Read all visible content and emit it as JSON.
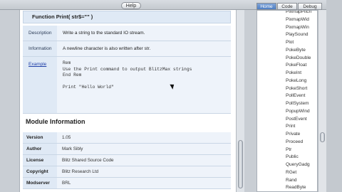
{
  "toolbar": {
    "help_label": "Help"
  },
  "function": {
    "title": "Function Print( str$=\"\" )",
    "rows": [
      {
        "key": "Description",
        "value": "Write a string to the standard IO stream."
      },
      {
        "key": "Information",
        "value": "A newline character is also written after str."
      }
    ],
    "example_key": "Example",
    "example_code": "Rem\nUse the Print command to output BlitzMax strings\nEnd Rem\n\nPrint \"Hello World\""
  },
  "module": {
    "title": "Module Information",
    "rows": [
      {
        "key": "Version",
        "value": "1.05"
      },
      {
        "key": "Author",
        "value": "Mark Sibly"
      },
      {
        "key": "License",
        "value": "Blitz Shared Source Code"
      },
      {
        "key": "Copyright",
        "value": "Blitz Research Ltd"
      },
      {
        "key": "Modserver",
        "value": "BRL"
      }
    ]
  },
  "sidebar": {
    "tabs": [
      "Home",
      "Code",
      "Debug"
    ],
    "active_tab": "Home",
    "items": [
      "PixmapPitch",
      "PixmapWid",
      "PixmapWin",
      "PlaySound",
      "Plot",
      "PokeByte",
      "PokeDouble",
      "PokeFloat",
      "PokeInt",
      "PokeLong",
      "PokeShort",
      "PollEvent",
      "PollSystem",
      "PopupWind",
      "PostEvent",
      "Print",
      "Private",
      "Proceed",
      "Ptr",
      "Public",
      "QueryGadg",
      "RGet",
      "Rand",
      "ReadByte"
    ]
  },
  "colors": {
    "header_bg": "#dfe9f5",
    "cell_bg": "#eef3fa",
    "active_tab": "#4f7fc4",
    "link": "#1f3fa8"
  }
}
